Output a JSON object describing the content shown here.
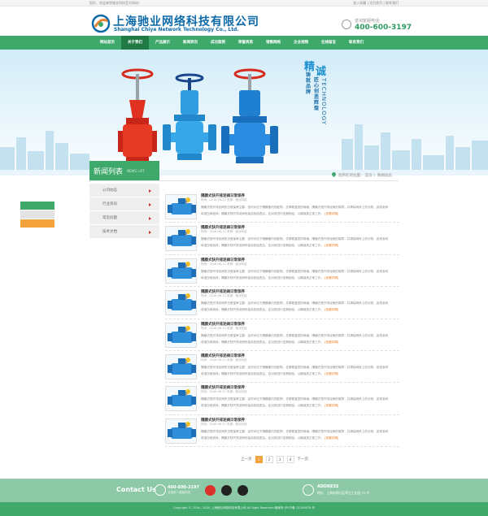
{
  "topbar": {
    "welcome": "您好，欢迎来到驰业科技官方网站！",
    "links": "加入收藏 | 设为首页 | 联系我们"
  },
  "logo": {
    "cn": "上海驰业网络科技有限公司",
    "en": "Shanghai Chiye Network Technology Co., Ltd."
  },
  "hotline": {
    "label": "咨询客服电话:",
    "number": "400-600-3197"
  },
  "nav": {
    "items": [
      "网站首页",
      "关于我们",
      "产品展示",
      "新闻资讯",
      "成功案例",
      "荣誉资质",
      "销售网络",
      "企业视频",
      "在线留言",
      "联系我们"
    ],
    "active_index": 1
  },
  "banner": {
    "slogan_big1": "精",
    "slogan_big2": "诚",
    "slogan_line1": "铸就品牌",
    "slogan_line2": "匠心创造辉煌",
    "slogan_en": "TECHNOLOGY"
  },
  "newsboard": {
    "title": "新闻列表",
    "sub": "NEWS LIST"
  },
  "breadcrumb": "您所在的位置：  首页 〉新闻动态",
  "sidemenu": [
    "公司动态",
    "行业资讯",
    "常见问题",
    "技术文档"
  ],
  "news": {
    "items": [
      {
        "title": "隔膜式快开排泥阀日常保养",
        "meta": "时间：2016-06-12   来源：驰业科技",
        "desc": "隔膜式快开排泥阀的日常保养主要：定时对位于隔膜管内的脏物，去掉覆盖层的网格，隔膜式快开排泥阀的故障，并清除阀体上的污物，该排泥阀",
        "desc2": "将液压阀液体；隔膜式快开排泥阀所装设检验表后，应对其进行定期检验，以确保其正常工作。",
        "more": "[查看详情]"
      },
      {
        "title": "隔膜式快开排泥阀日常保养",
        "meta": "时间：2016-06-12   来源：驰业科技",
        "desc": "隔膜式快开排泥阀的日常保养主要：定时对位于隔膜管内的脏物，去掉覆盖层的网格，隔膜式快开排泥阀的故障，并清除阀体上的污物，该排泥阀",
        "desc2": "将液压阀液体；隔膜式快开排泥阀所装设检验表后，应对其进行定期检验，以确保其正常工作。",
        "more": "[查看详情]"
      },
      {
        "title": "隔膜式快开排泥阀日常保养",
        "meta": "时间：2016-06-12   来源：驰业科技",
        "desc": "隔膜式快开排泥阀的日常保养主要：定时对位于隔膜管内的脏物，去掉覆盖层的网格，隔膜式快开排泥阀的故障，并清除阀体上的污物，该排泥阀",
        "desc2": "将液压阀液体；隔膜式快开排泥阀所装设检验表后，应对其进行定期检验，以确保其正常工作。",
        "more": "[查看详情]"
      },
      {
        "title": "隔膜式快开排泥阀日常保养",
        "meta": "时间：2016-06-12   来源：驰业科技",
        "desc": "隔膜式快开排泥阀的日常保养主要：定时对位于隔膜管内的脏物，去掉覆盖层的网格，隔膜式快开排泥阀的故障，并清除阀体上的污物，该排泥阀",
        "desc2": "将液压阀液体；隔膜式快开排泥阀所装设检验表后，应对其进行定期检验，以确保其正常工作。",
        "more": "[查看详情]"
      },
      {
        "title": "隔膜式快开排泥阀日常保养",
        "meta": "时间：2016-06-12   来源：驰业科技",
        "desc": "隔膜式快开排泥阀的日常保养主要：定时对位于隔膜管内的脏物，去掉覆盖层的网格，隔膜式快开排泥阀的故障，并清除阀体上的污物，该排泥阀",
        "desc2": "将液压阀液体；隔膜式快开排泥阀所装设检验表后，应对其进行定期检验，以确保其正常工作。",
        "more": "[查看详情]"
      },
      {
        "title": "隔膜式快开排泥阀日常保养",
        "meta": "时间：2016-06-12   来源：驰业科技",
        "desc": "隔膜式快开排泥阀的日常保养主要：定时对位于隔膜管内的脏物，去掉覆盖层的网格，隔膜式快开排泥阀的故障，并清除阀体上的污物，该排泥阀",
        "desc2": "将液压阀液体；隔膜式快开排泥阀所装设检验表后，应对其进行定期检验，以确保其正常工作。",
        "more": "[查看详情]"
      },
      {
        "title": "隔膜式快开排泥阀日常保养",
        "meta": "时间：2016-06-12   来源：驰业科技",
        "desc": "隔膜式快开排泥阀的日常保养主要：定时对位于隔膜管内的脏物，去掉覆盖层的网格，隔膜式快开排泥阀的故障，并清除阀体上的污物，该排泥阀",
        "desc2": "将液压阀液体；隔膜式快开排泥阀所装设检验表后，应对其进行定期检验，以确保其正常工作。",
        "more": "[查看详情]"
      },
      {
        "title": "隔膜式快开排泥阀日常保养",
        "meta": "时间：2016-06-12   来源：驰业科技",
        "desc": "隔膜式快开排泥阀的日常保养主要：定时对位于隔膜管内的脏物，去掉覆盖层的网格，隔膜式快开排泥阀的故障，并清除阀体上的污物，该排泥阀",
        "desc2": "将液压阀液体；隔膜式快开排泥阀所装设检验表后，应对其进行定期检验，以确保其正常工作。",
        "more": "[查看详情]"
      }
    ]
  },
  "pager": {
    "prev": "上一页",
    "pages": [
      "1",
      "2",
      "3",
      "4"
    ],
    "current": "1",
    "next": "下一页"
  },
  "footer": {
    "contact_us": "Contact Us",
    "tel": "400-600-3197",
    "tel_sub": "全国统一客服热线",
    "address_title": "ADDRESS",
    "address": "地址：上海市闵行区莘庄工业园 73 号",
    "copyright": "Copyright © 2016 - 2020  上海驰业网络科技有限公司  All Right Reserved   备案号:沪ICP备 12345678 号"
  },
  "colors": {
    "brand_green": "#3fa86b",
    "dark_green": "#1f7a44",
    "accent_orange": "#f4a23b",
    "logo_blue": "#0c6aa8"
  }
}
